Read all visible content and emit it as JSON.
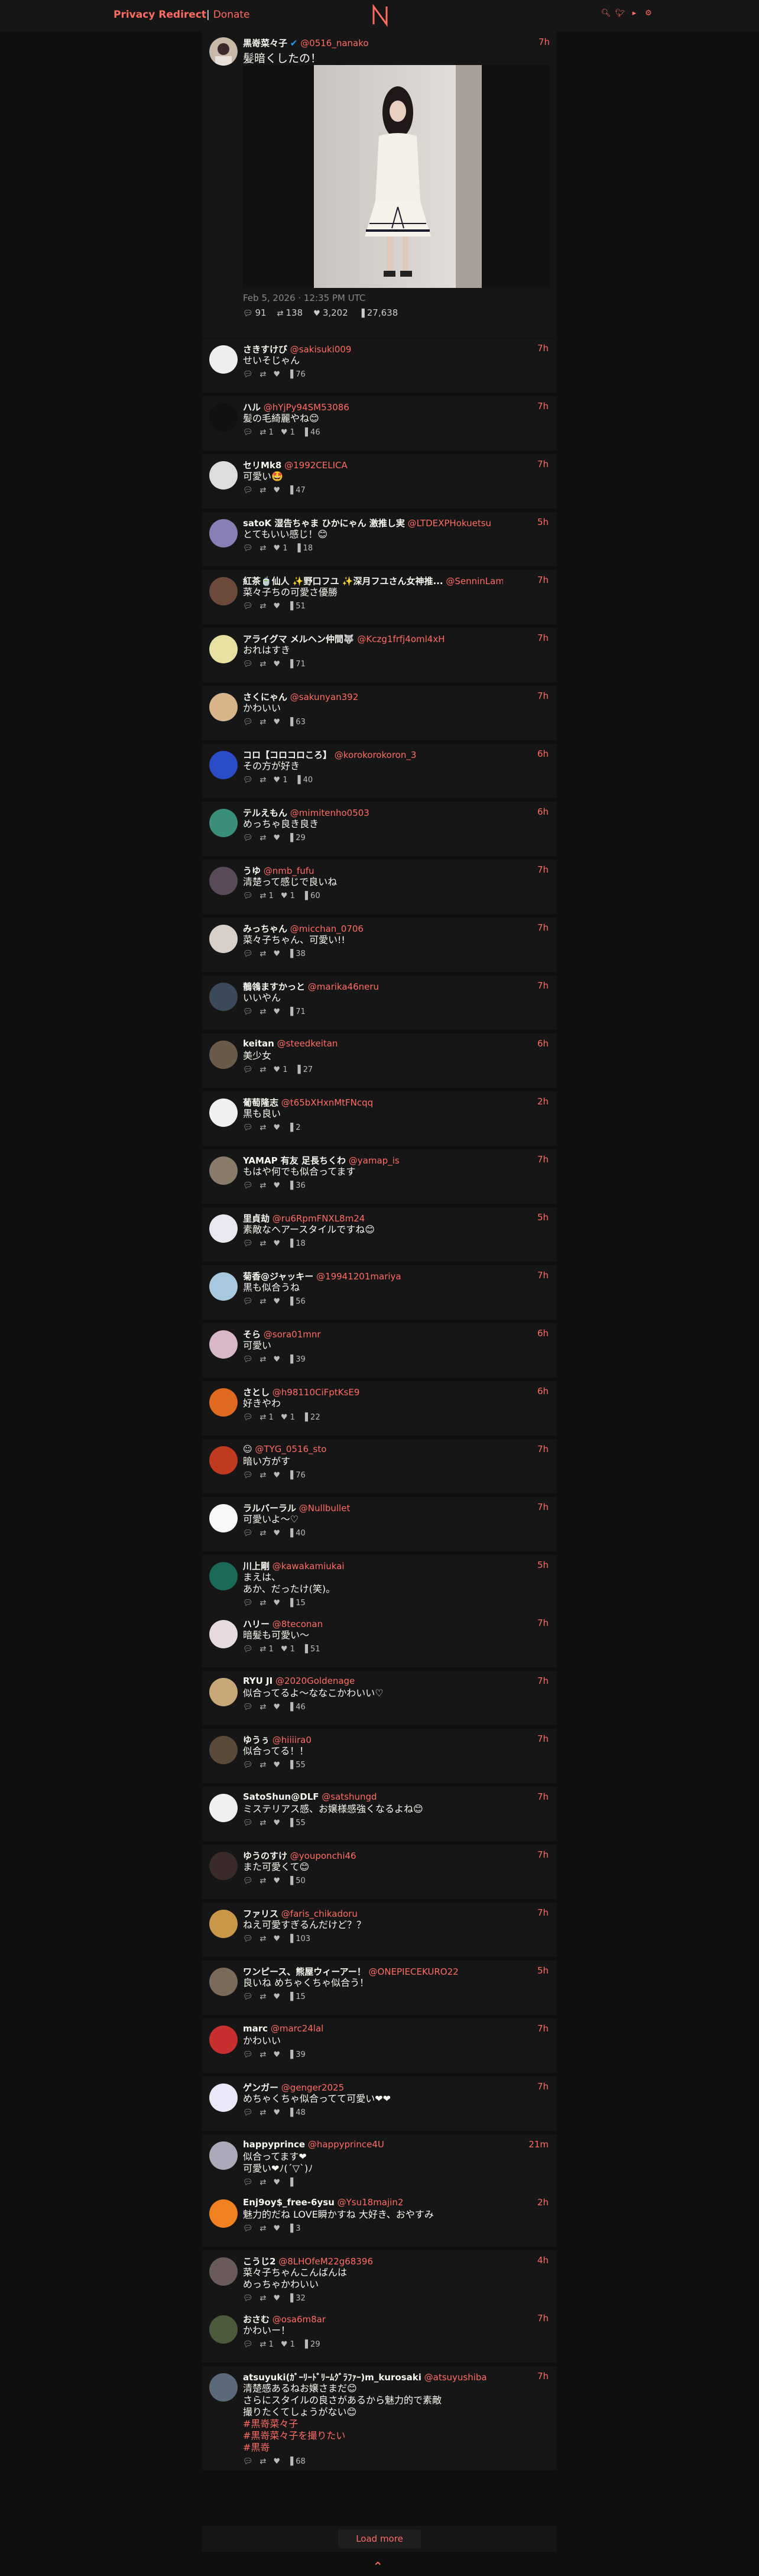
{
  "nav": {
    "brand": "Privacy Redirect",
    "sep": "|",
    "donate": "Donate"
  },
  "main_tweet": {
    "fullname": "黒嵜菜々子",
    "username": "@0516_nanako",
    "date": "7h",
    "text": "髪暗くしたの！",
    "meta": "Feb 5, 2026 · 12:35 PM UTC",
    "replies": "91",
    "retweets": "138",
    "likes": "3,202",
    "views": "27,638"
  },
  "replies": [
    {
      "name": "さきすけび",
      "user": "@sakisuki009",
      "time": "7h",
      "text": "せいそじゃん",
      "r": "",
      "rt": "",
      "l": "",
      "v": "76",
      "av": "#eee"
    },
    {
      "name": "ハル",
      "user": "@hYjPy94SM53086",
      "time": "7h",
      "text": "髪の毛綺麗やね😊",
      "r": "",
      "rt": "1",
      "l": "1",
      "v": "46",
      "av": "#111"
    },
    {
      "name": "セリMk8",
      "user": "@1992CELICA",
      "time": "7h",
      "text": "可愛い🤩",
      "r": "",
      "rt": "",
      "l": "",
      "v": "47",
      "av": "#ddd"
    },
    {
      "name": "satoK 湿告ちゃま ひかにゃん 激推し実",
      "user": "@LTDEXPHokuetsu",
      "time": "5h",
      "text": "とてもいい感じ！😊",
      "r": "",
      "rt": "",
      "l": "1",
      "v": "18",
      "av": "#8a7fb5"
    },
    {
      "name": "紅茶🍵仙人 ✨野口フユ ✨深月フユさん女神推...",
      "user": "@SenninLamia...",
      "time": "7h",
      "text": "菜々子ちの可愛さ優勝",
      "r": "",
      "rt": "",
      "l": "",
      "v": "51",
      "av": "#6b4a3c"
    },
    {
      "name": "アライグマ メルヘン仲間🐺",
      "user": "@Kczg1frfj4oml4xH",
      "time": "7h",
      "text": "おれはすき",
      "r": "",
      "rt": "",
      "l": "",
      "v": "71",
      "av": "#e8e0a0"
    },
    {
      "name": "さくにゃん",
      "user": "@sakunyan392",
      "time": "7h",
      "text": "かわいい",
      "r": "",
      "rt": "",
      "l": "",
      "v": "63",
      "av": "#d9b48a"
    },
    {
      "name": "コロ【コロコロころ】",
      "user": "@korokorokoron_3",
      "time": "6h",
      "text": "その方が好き",
      "r": "",
      "rt": "",
      "l": "1",
      "v": "40",
      "av": "#2b4cc7"
    },
    {
      "name": "テルえもん",
      "user": "@mimitenho0503",
      "time": "6h",
      "text": "めっちゃ良き良き",
      "r": "",
      "rt": "",
      "l": "",
      "v": "29",
      "av": "#3a8f7a"
    },
    {
      "name": "うゆ",
      "user": "@nmb_fufu",
      "time": "7h",
      "text": "清楚って感じで良いね",
      "r": "",
      "rt": "1",
      "l": "1",
      "v": "60",
      "av": "#5a4a5a"
    },
    {
      "name": "みっちゃん",
      "user": "@micchan_0706",
      "time": "7h",
      "text": "菜々子ちゃん、可愛い!!",
      "r": "",
      "rt": "",
      "l": "",
      "v": "38",
      "av": "#d8d0c8"
    },
    {
      "name": "鶺鴒ますかっと",
      "user": "@marika46neru",
      "time": "7h",
      "text": "いいやん",
      "r": "",
      "rt": "",
      "l": "",
      "v": "71",
      "av": "#3a4a5a"
    },
    {
      "name": "keitan",
      "user": "@steedkeitan",
      "time": "6h",
      "text": "美少女",
      "r": "",
      "rt": "",
      "l": "1",
      "v": "27",
      "av": "#6a5a4a"
    },
    {
      "name": "葡萄隆志",
      "user": "@t65bXHxnMtFNcqq",
      "time": "2h",
      "text": "黒も良い",
      "r": "",
      "rt": "",
      "l": "",
      "v": "2",
      "av": "#f0f0f0"
    },
    {
      "name": "YAMAP 有友 足長ちくわ",
      "user": "@yamap_is",
      "time": "7h",
      "text": "もはや何でも似合ってます",
      "r": "",
      "rt": "",
      "l": "",
      "v": "36",
      "av": "#8a7a6a"
    },
    {
      "name": "里貞劫",
      "user": "@ru6RpmFNXL8m24",
      "time": "5h",
      "text": "素敵なヘアースタイルですね😊",
      "r": "",
      "rt": "",
      "l": "",
      "v": "18",
      "av": "#e8e8f0"
    },
    {
      "name": "菊香@ジャッキー",
      "user": "@19941201mariya",
      "time": "7h",
      "text": "黒も似合うね",
      "r": "",
      "rt": "",
      "l": "",
      "v": "56",
      "av": "#a8c8e0"
    },
    {
      "name": "そら",
      "user": "@sora01mnr",
      "time": "6h",
      "text": "可愛い",
      "r": "",
      "rt": "",
      "l": "",
      "v": "39",
      "av": "#d8b8c8"
    },
    {
      "name": "さとし",
      "user": "@h98110CiFptKsE9",
      "time": "6h",
      "text": "好きやわ",
      "r": "",
      "rt": "1",
      "l": "1",
      "v": "22",
      "av": "#e06a20"
    },
    {
      "name": "☺",
      "user": "@TYG_0516_sto",
      "time": "7h",
      "text": "暗い方がす",
      "r": "",
      "rt": "",
      "l": "",
      "v": "76",
      "av": "#c03a20"
    },
    {
      "name": "ラルバーラル",
      "user": "@Nullbullet",
      "time": "7h",
      "text": "可愛いよ〜♡",
      "r": "",
      "rt": "",
      "l": "",
      "v": "40",
      "av": "#f8f8f8"
    },
    {
      "name": "川上剛",
      "user": "@kawakamiukai",
      "time": "5h",
      "text": "まえは、|あか、だったけ(笑)。",
      "r": "",
      "rt": "",
      "l": "",
      "v": "15",
      "av": "#1a6a5a"
    },
    {
      "name": "ハリー",
      "user": "@8teconan",
      "time": "7h",
      "text": "暗髪も可愛い〜",
      "r": "",
      "rt": "1",
      "l": "1",
      "v": "51",
      "av": "#e8d8e0"
    },
    {
      "name": "RYU JI",
      "user": "@2020Goldenage",
      "time": "7h",
      "text": "似合ってるよ〜ななこかわいい♡",
      "r": "",
      "rt": "",
      "l": "",
      "v": "46",
      "av": "#c8a878"
    },
    {
      "name": "ゆうぅ",
      "user": "@hiiiira0",
      "time": "7h",
      "text": "似合ってる！！",
      "r": "",
      "rt": "",
      "l": "",
      "v": "55",
      "av": "#5a4a3a"
    },
    {
      "name": "SatoShun@DLF",
      "user": "@satshungd",
      "time": "7h",
      "text": "ミステリアス感、お嬢様感強くなるよね😊",
      "r": "",
      "rt": "",
      "l": "",
      "v": "55",
      "av": "#f0f0f0"
    },
    {
      "name": "ゆうのすけ",
      "user": "@youponchi46",
      "time": "7h",
      "text": "また可愛くて😊",
      "r": "",
      "rt": "",
      "l": "",
      "v": "50",
      "av": "#3a2a2a"
    },
    {
      "name": "ファリス",
      "user": "@faris_chikadoru",
      "time": "7h",
      "text": "ねえ可愛すぎるんだけど？？",
      "r": "",
      "rt": "",
      "l": "",
      "v": "103",
      "av": "#c89848"
    },
    {
      "name": "ワンピース、熊屋ウィーアー！",
      "user": "@ONEPIECEKURO22",
      "time": "5h",
      "text": "良いね めちゃくちゃ似合う！",
      "r": "",
      "rt": "",
      "l": "",
      "v": "15",
      "av": "#7a6a5a"
    },
    {
      "name": "marc",
      "user": "@marc24lal",
      "time": "7h",
      "text": "かわいい",
      "r": "",
      "rt": "",
      "l": "",
      "v": "39",
      "av": "#c83030"
    },
    {
      "name": "ゲンガー",
      "user": "@genger2025",
      "time": "7h",
      "text": "めちゃくちゃ似合ってて可愛い❤❤",
      "r": "",
      "rt": "",
      "l": "",
      "v": "48",
      "av": "#e8e8f8"
    },
    {
      "name": "happyprince",
      "user": "@happyprince4U",
      "time": "21m",
      "text": "似合ってます❤|可愛い❤ﾉ(´▽`)ﾉ",
      "r": "",
      "rt": "",
      "l": "",
      "v": "",
      "av": "#aab"
    },
    {
      "name": "Enj9oy$_free-6ysu",
      "user": "@Ysu18majin2",
      "time": "2h",
      "text": "魅力的だね LOVE瞬かすね 大好き、おやすみ",
      "r": "",
      "rt": "",
      "l": "",
      "v": "3",
      "av": "#f08020"
    },
    {
      "name": "こうじ2",
      "user": "@8LHOfeM22g68396",
      "time": "4h",
      "text": "菜々子ちゃんこんばんは|めっちゃかわいい",
      "r": "",
      "rt": "",
      "l": "",
      "v": "32",
      "av": "#6a5a5a"
    },
    {
      "name": "おさむ",
      "user": "@osa6m8ar",
      "time": "7h",
      "text": "かわいー！",
      "r": "",
      "rt": "1",
      "l": "1",
      "v": "29",
      "av": "#4a5a3a"
    },
    {
      "name": "atsuyuki(ｶﾞｰﾘｰﾄﾞﾘｰﾑｸﾞﾗﾌｧｰ)m_kurosaki",
      "user": "@atsuyushiba",
      "time": "7h",
      "text": "清楚感あるねお嬢さまだ😊|さらにスタイルの良さがあるから魅力的で素敵|撮りたくてしょうがない😊",
      "tags": [
        "#黒嵜菜々子",
        "#黒嵜菜々子を撮りたい",
        "#黒嵜"
      ],
      "r": "",
      "rt": "",
      "l": "",
      "v": "68",
      "av": "#5a6a7a"
    }
  ],
  "load_more": "Load more"
}
